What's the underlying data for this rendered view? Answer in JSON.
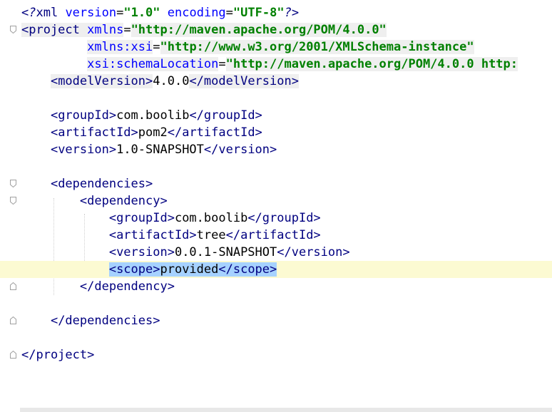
{
  "editor": {
    "lines": [
      {
        "segments": [
          {
            "c": "pi",
            "t": "<?"
          },
          {
            "c": "tag",
            "t": "xml "
          },
          {
            "c": "attr",
            "t": "version"
          },
          {
            "c": "txt",
            "t": "="
          },
          {
            "c": "str",
            "t": "\"1.0\""
          },
          {
            "c": "txt",
            "t": " "
          },
          {
            "c": "attr",
            "t": "encoding"
          },
          {
            "c": "txt",
            "t": "="
          },
          {
            "c": "str",
            "t": "\"UTF-8\""
          },
          {
            "c": "pi",
            "t": "?>"
          }
        ]
      },
      {
        "segments": [
          {
            "c": "tag",
            "t": "<project "
          },
          {
            "c": "attr",
            "t": "xmlns"
          },
          {
            "c": "txt",
            "t": "="
          },
          {
            "c": "str",
            "t": "\"http://maven.apache.org/POM/4.0.0\""
          }
        ]
      },
      {
        "segments": [
          {
            "c": "txt",
            "t": "         "
          },
          {
            "c": "attr",
            "t": "xmlns:xsi"
          },
          {
            "c": "txt",
            "t": "="
          },
          {
            "c": "str",
            "t": "\"http://www.w3.org/2001/XMLSchema-instance\""
          }
        ]
      },
      {
        "segments": [
          {
            "c": "txt",
            "t": "         "
          },
          {
            "c": "attr",
            "t": "xsi:schemaLocation"
          },
          {
            "c": "txt",
            "t": "="
          },
          {
            "c": "str",
            "t": "\"http://maven.apache.org/POM/4.0.0 http:"
          }
        ]
      },
      {
        "segments": [
          {
            "c": "txt",
            "t": "    "
          },
          {
            "c": "tag",
            "t": "<modelVersion>"
          },
          {
            "c": "txt",
            "t": "4.0.0"
          },
          {
            "c": "tag",
            "t": "</modelVersion>"
          }
        ]
      },
      {
        "segments": []
      },
      {
        "segments": [
          {
            "c": "txt",
            "t": "    "
          },
          {
            "c": "tag",
            "t": "<groupId>"
          },
          {
            "c": "txt",
            "t": "com.boolib"
          },
          {
            "c": "tag",
            "t": "</groupId>"
          }
        ]
      },
      {
        "segments": [
          {
            "c": "txt",
            "t": "    "
          },
          {
            "c": "tag",
            "t": "<artifactId>"
          },
          {
            "c": "txt",
            "t": "pom2"
          },
          {
            "c": "tag",
            "t": "</artifactId>"
          }
        ]
      },
      {
        "segments": [
          {
            "c": "txt",
            "t": "    "
          },
          {
            "c": "tag",
            "t": "<version>"
          },
          {
            "c": "txt",
            "t": "1.0-SNAPSHOT"
          },
          {
            "c": "tag",
            "t": "</version>"
          }
        ]
      },
      {
        "segments": []
      },
      {
        "segments": [
          {
            "c": "txt",
            "t": "    "
          },
          {
            "c": "tag",
            "t": "<dependencies>"
          }
        ]
      },
      {
        "segments": [
          {
            "c": "txt",
            "t": "        "
          },
          {
            "c": "tag",
            "t": "<dependency>"
          }
        ]
      },
      {
        "segments": [
          {
            "c": "txt",
            "t": "            "
          },
          {
            "c": "tag",
            "t": "<groupId>"
          },
          {
            "c": "txt",
            "t": "com.boolib"
          },
          {
            "c": "tag",
            "t": "</groupId>"
          }
        ]
      },
      {
        "segments": [
          {
            "c": "txt",
            "t": "            "
          },
          {
            "c": "tag",
            "t": "<artifactId>"
          },
          {
            "c": "txt",
            "t": "tree"
          },
          {
            "c": "tag",
            "t": "</artifactId>"
          }
        ]
      },
      {
        "segments": [
          {
            "c": "txt",
            "t": "            "
          },
          {
            "c": "tag",
            "t": "<version>"
          },
          {
            "c": "txt",
            "t": "0.0.1-SNAPSHOT"
          },
          {
            "c": "tag",
            "t": "</version>"
          }
        ]
      },
      {
        "segments": [
          {
            "c": "txt",
            "t": "            "
          },
          {
            "c": "tag sel",
            "t": "<scope>"
          },
          {
            "c": "txt sel",
            "t": "provided"
          },
          {
            "c": "caret",
            "t": ""
          },
          {
            "c": "tag sel",
            "t": "</scope>"
          }
        ]
      },
      {
        "segments": [
          {
            "c": "txt",
            "t": "        "
          },
          {
            "c": "tag",
            "t": "</dependency>"
          }
        ]
      },
      {
        "segments": []
      },
      {
        "segments": [
          {
            "c": "txt",
            "t": "    "
          },
          {
            "c": "tag",
            "t": "</dependencies>"
          }
        ]
      },
      {
        "segments": []
      },
      {
        "segments": [
          {
            "c": "tag",
            "t": "</project>"
          }
        ]
      }
    ],
    "caret_line": 16,
    "highlighted_tag_lines": [
      2,
      3,
      4
    ]
  }
}
